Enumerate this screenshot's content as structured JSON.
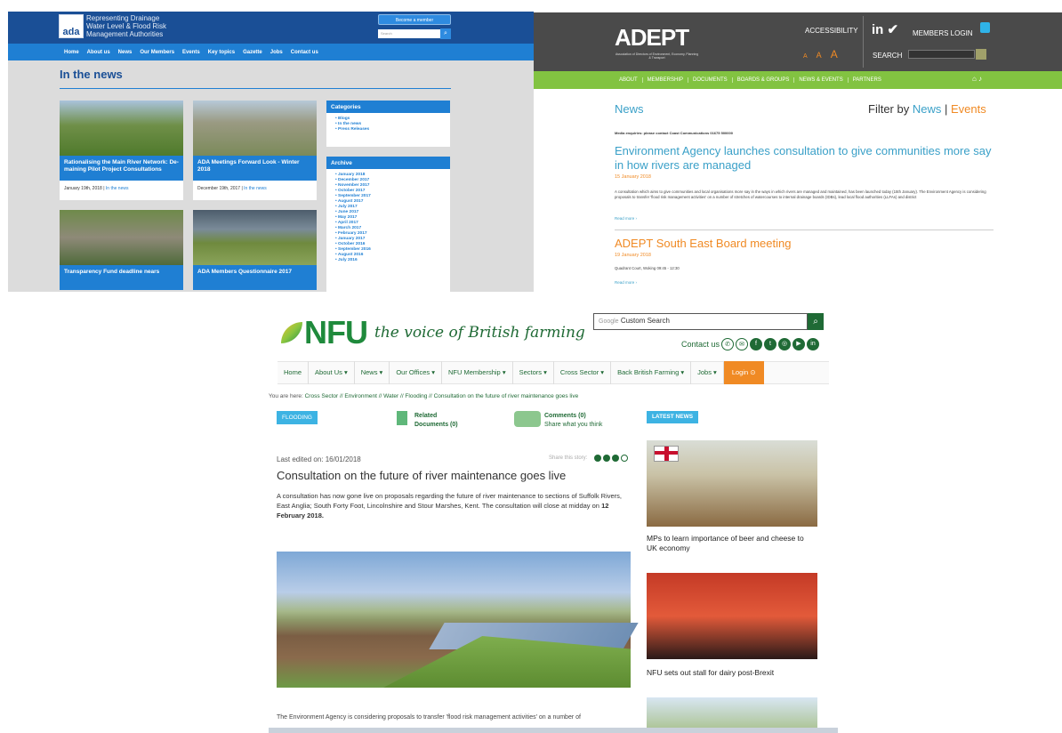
{
  "ada": {
    "logo_abbr": "ada",
    "logo_text": [
      "Representing Drainage",
      "Water Level & Flood Risk",
      "Management Authorities"
    ],
    "member_btn": "Become a member",
    "search_placeholder": "Search",
    "nav": [
      "Home",
      "About us",
      "News",
      "Our Members",
      "Events",
      "Key topics",
      "Gazette",
      "Jobs",
      "Contact us"
    ],
    "title": "In the news",
    "cards": [
      {
        "caption": "Rationalising the Main River Network: De-maining Pilot Project Consultations",
        "date": "January 19th, 2018",
        "cat": "In the news"
      },
      {
        "caption": "ADA Meetings Forward Look - Winter 2018",
        "date": "December 19th, 2017",
        "cat": "In the news"
      },
      {
        "caption": "Transparency Fund deadline nears"
      },
      {
        "caption": "ADA Members Questionnaire 2017"
      }
    ],
    "categories_title": "Categories",
    "categories": [
      "Blogs",
      "In the news",
      "Press Releases"
    ],
    "archive_title": "Archive",
    "archive": [
      "January 2018",
      "December 2017",
      "November 2017",
      "October 2017",
      "September 2017",
      "August 2017",
      "July 2017",
      "June 2017",
      "May 2017",
      "April 2017",
      "March 2017",
      "February 2017",
      "January 2017",
      "October 2016",
      "September 2016",
      "August 2016",
      "July 2016"
    ]
  },
  "adept": {
    "logo": "ADEPT",
    "logo_sub": "Association of Directors of Environment, Economy, Planning & Transport",
    "accessibility": "ACCESSIBILITY",
    "members_login": "MEMBERS LOGIN",
    "font_sizes": [
      "A",
      "A",
      "A"
    ],
    "search_label": "SEARCH",
    "nav": [
      "ABOUT",
      "MEMBERSHIP",
      "DOCUMENTS",
      "BOARDS & GROUPS",
      "NEWS & EVENTS",
      "PARTNERS"
    ],
    "news_title": "News",
    "filter_prefix": "Filter by",
    "filter_news": "News",
    "filter_sep": "|",
    "filter_events": "Events",
    "media": "Media enquiries: please contact Coast Communications 01675 500000",
    "article1": {
      "title": "Environment Agency launches consultation to give communities more say in how rivers are managed",
      "date": "15 January 2018",
      "text": "A consultation which aims to give communities and local organisations more say in the ways in which rivers are managed and maintained, has been launched today (15th January). The Environment Agency is considering proposals to transfer 'flood risk management activities' on a number of stretches of watercourses to internal drainage boards (IDBs), lead local flood authorities (LLFAs) and district",
      "read": "Read more ›"
    },
    "article2": {
      "title": "ADEPT South East Board meeting",
      "date": "19 January 2018",
      "text": "Quadrant Court, Woking 09:45 - 12:30",
      "read": "Read more ›"
    }
  },
  "nfu": {
    "logo": "NFU",
    "tagline": "the voice of British farming",
    "search_google": "Google",
    "search_placeholder": "Custom Search",
    "contact": "Contact us",
    "nav": [
      "Home",
      "About Us ▾",
      "News ▾",
      "Our Offices ▾",
      "NFU Membership ▾",
      "Sectors ▾",
      "Cross Sector ▾",
      "Back British Farming ▾",
      "Jobs ▾",
      "Login ⊙"
    ],
    "breadcrumb_prefix": "You are here:",
    "breadcrumb": "Cross Sector // Environment // Water // Flooding // Consultation on the future of river maintenance goes live",
    "tag": "FLOODING",
    "related": "Related",
    "related2": "Documents (0)",
    "comments": "Comments (0)",
    "comments2": "Share what you think",
    "edited": "Last edited on: 16/01/2018",
    "share": "Share this story:",
    "title": "Consultation on the future of river maintenance goes live",
    "lead": "A consultation has now gone live on proposals regarding the future of river maintenance to sections of Suffolk Rivers, East Anglia; South Forty Foot, Lincolnshire and Stour Marshes, Kent. The consultation will close at midday on",
    "lead_bold": "12 February 2018.",
    "body": "The Environment Agency is considering proposals to transfer 'flood risk management activities' on a number of",
    "latest": "LATEST NEWS",
    "news1": "MPs to learn importance of beer and cheese to UK economy",
    "news2": "NFU sets out stall for dairy post-Brexit",
    "colors": {
      "green": "#1f6a35",
      "orange": "#f08a24",
      "blue": "#3db3e3"
    }
  }
}
